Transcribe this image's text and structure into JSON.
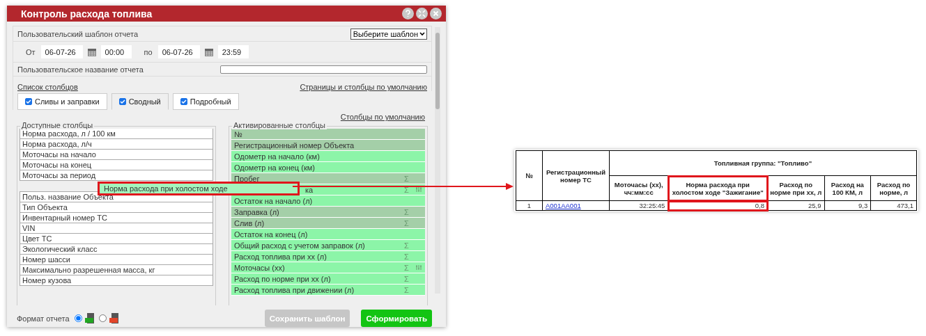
{
  "window": {
    "title": "Контроль расхода топлива"
  },
  "template": {
    "label": "Пользовательский шаблон отчета",
    "select": "Выберите шаблон"
  },
  "period": {
    "from_label": "От",
    "from_date": "06-07-26",
    "from_time": "00:00",
    "to_label": "по",
    "to_date": "06-07-26",
    "to_time": "23:59"
  },
  "report_name": {
    "label": "Пользовательское название отчета"
  },
  "columns_link": "Список столбцов",
  "defaults_link": "Страницы и столбцы по умолчанию",
  "tabs": [
    {
      "label": "Сливы и заправки",
      "checked": true,
      "selected": false
    },
    {
      "label": "Сводный",
      "checked": true,
      "selected": true
    },
    {
      "label": "Подробный",
      "checked": true,
      "selected": false
    }
  ],
  "column_defaults_link": "Столбцы по умолчанию",
  "available": {
    "title": "Доступные столбцы",
    "items_top": [
      "Норма расхода, л / 100 км",
      "Норма расхода, л/ч",
      "Моточасы на начало",
      "Моточасы на конец",
      "Моточасы за период"
    ],
    "items_bottom": [
      "Польз. название Объекта",
      "Тип Объекта",
      "Инвентарный номер ТС",
      "VIN",
      "Цвет ТС",
      "Экологический класс",
      "Номер шасси",
      "Максимально разрешенная масса, кг",
      "Номер кузова"
    ]
  },
  "activated": {
    "title": "Активированные столбцы",
    "items": [
      {
        "label": "№",
        "selected": true,
        "filter": false
      },
      {
        "label": "Регистрационный номер Объекта",
        "selected": true,
        "filter": false
      },
      {
        "label": "Одометр на начало (км)",
        "selected": false,
        "filter": false
      },
      {
        "label": "Одометр на конец (км)",
        "selected": false,
        "filter": false
      },
      {
        "label": "Пробег",
        "selected": true,
        "sum": "Σ",
        "filter": false
      },
      {
        "label": "ка",
        "selected": false,
        "sum": "Σ",
        "filter": true
      },
      {
        "label": "Остаток на начало (л)",
        "selected": false,
        "filter": false
      },
      {
        "label": "Заправка (л)",
        "selected": true,
        "sum": "Σ",
        "filter": false
      },
      {
        "label": "Слив (л)",
        "selected": true,
        "sum": "Σ",
        "filter": false
      },
      {
        "label": "Остаток на конец (л)",
        "selected": false,
        "filter": false
      },
      {
        "label": "Общий расход с учетом заправок (л)",
        "selected": false,
        "sum": "Σ",
        "filter": false
      },
      {
        "label": "Расход топлива при хх (л)",
        "selected": false,
        "sum": "Σ",
        "filter": false
      },
      {
        "label": "Моточасы (хх)",
        "selected": false,
        "sum": "Σ",
        "filter": true
      },
      {
        "label": "Расход по норме при хх (л)",
        "selected": false,
        "sum": "Σ",
        "filter": false
      },
      {
        "label": "Расход топлива при движении (л)",
        "selected": false,
        "sum": "Σ",
        "filter": false
      }
    ]
  },
  "dragged_item": "Норма расхода при холостом ходе",
  "format": {
    "label": "Формат отчета",
    "options": [
      {
        "kind": "xls",
        "selected": true
      },
      {
        "kind": "pdf",
        "selected": false
      }
    ]
  },
  "buttons": [
    {
      "label": "Сохранить шаблон",
      "disabled": true
    },
    {
      "label": "Сформировать",
      "disabled": false
    }
  ],
  "report_table": {
    "header_no": "№",
    "header_reg": "Регистрационный номер ТС",
    "group": "Топливная группа: \"Топливо\"",
    "columns": [
      {
        "label": "Моточасы (хх), чч:мм:сс",
        "highlighted": false
      },
      {
        "label": "Норма расхода при холостом ходе \"Зажигание\"",
        "highlighted": true
      },
      {
        "label": "Расход по норме при хх, л",
        "highlighted": false
      },
      {
        "label": "Расход на 100 КМ, л",
        "highlighted": false
      },
      {
        "label": "Расход по норме, л",
        "highlighted": false
      }
    ],
    "rows": [
      {
        "no": "1",
        "reg": "А001АА001",
        "values": [
          "32:25:45",
          "0,8",
          "25,9",
          "9,3",
          "473,1"
        ]
      }
    ]
  }
}
